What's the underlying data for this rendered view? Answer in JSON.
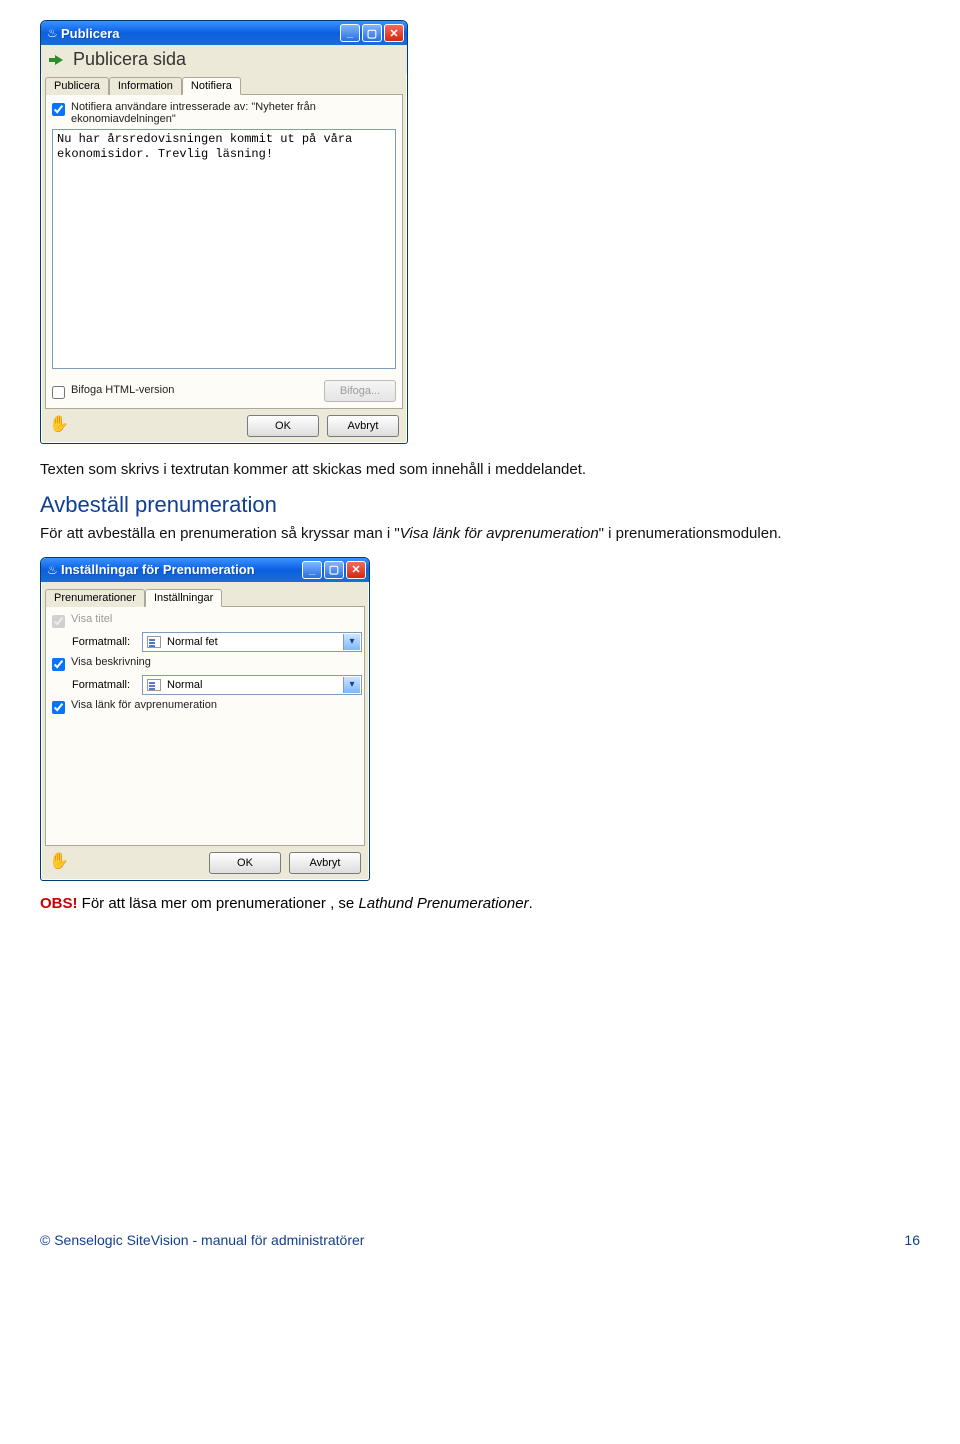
{
  "dialog1": {
    "title": "Publicera",
    "sub_title": "Publicera sida",
    "tabs": {
      "t1": "Publicera",
      "t2": "Information",
      "t3": "Notifiera"
    },
    "notify_label": "Notifiera användare intresserade av: \"Nyheter från ekonomiavdelningen\"",
    "message_text": "Nu har årsredovisningen kommit ut på våra\nekonomisidor. Trevlig läsning!",
    "attach_label": "Bifoga HTML-version",
    "attach_btn": "Bifoga...",
    "ok": "OK",
    "cancel": "Avbryt"
  },
  "paragraph1": "Texten som skrivs i textrutan kommer att skickas med som innehåll i meddelandet.",
  "heading": "Avbeställ prenumeration",
  "paragraph2_pre": "För att avbeställa en prenumeration så kryssar man i \"",
  "paragraph2_em": "Visa länk för avprenumeration",
  "paragraph2_post": "\" i prenumerationsmodulen.",
  "dialog2": {
    "title": "Inställningar för Prenumeration",
    "tabs": {
      "t1": "Prenumerationer",
      "t2": "Inställningar"
    },
    "show_title": "Visa titel",
    "format_label": "Formatmall:",
    "format1_value": "Normal fet",
    "show_desc": "Visa beskrivning",
    "format2_value": "Normal",
    "show_unsub": "Visa länk för avprenumeration",
    "ok": "OK",
    "cancel": "Avbryt"
  },
  "obs_label": "OBS!",
  "obs_text_pre": " För att läsa mer om prenumerationer , se ",
  "obs_em": "Lathund Prenumerationer",
  "obs_post": ".",
  "footer_left": "© Senselogic SiteVision - manual för administratörer",
  "footer_page": "16"
}
